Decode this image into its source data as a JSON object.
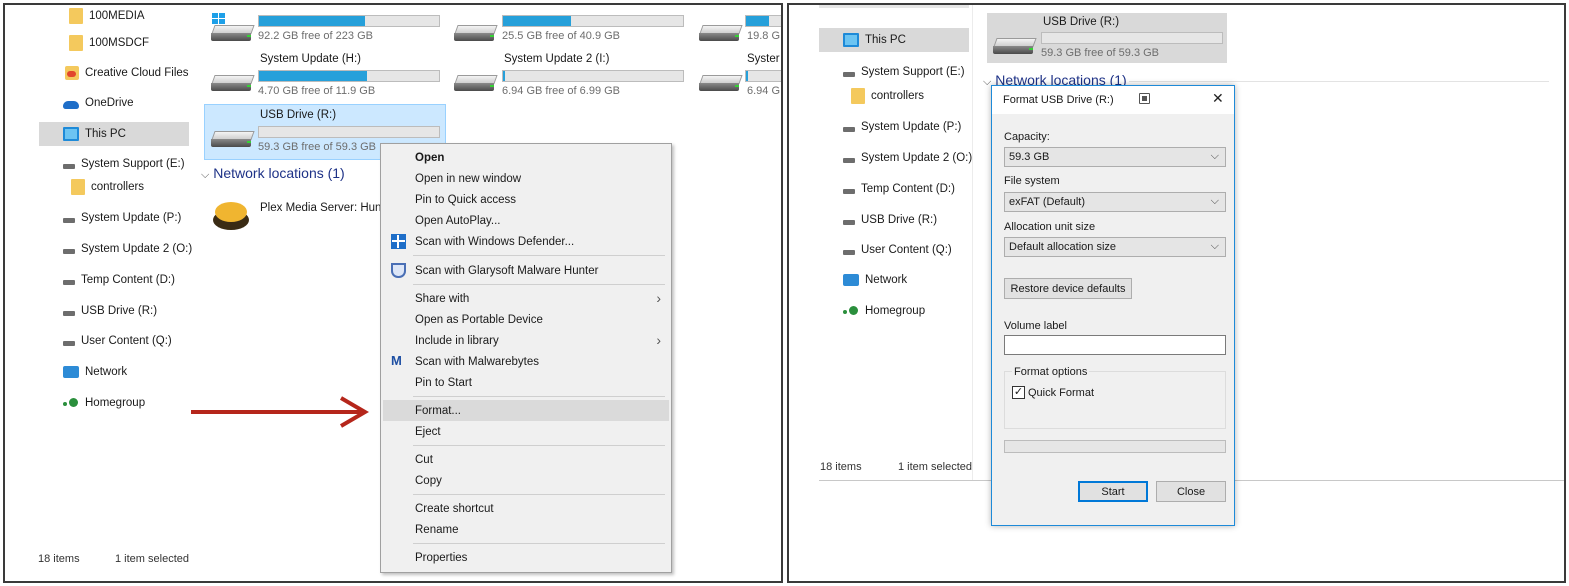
{
  "left": {
    "nav": {
      "items": [
        {
          "label": "100MEDIA"
        },
        {
          "label": "100MSDCF"
        },
        {
          "label": "Creative Cloud Files"
        },
        {
          "label": "OneDrive"
        },
        {
          "label": "This PC"
        },
        {
          "label": "System Support (E:)"
        },
        {
          "label": "controllers"
        },
        {
          "label": "System Update (P:)"
        },
        {
          "label": "System Update 2 (O:)"
        },
        {
          "label": "Temp Content (D:)"
        },
        {
          "label": "USB Drive (R:)"
        },
        {
          "label": "User Content (Q:)"
        },
        {
          "label": "Network"
        },
        {
          "label": "Homegroup"
        }
      ]
    },
    "drives": [
      {
        "title": "",
        "free": "92.2 GB free of 223 GB",
        "used_fraction": 0.59
      },
      {
        "title": "",
        "free": "25.5 GB free of 40.9 GB",
        "used_fraction": 0.38
      },
      {
        "title": "",
        "free": "19.8 G",
        "used_fraction": 0.6
      },
      {
        "title": "System Update (H:)",
        "free": "4.70 GB free of 11.9 GB",
        "used_fraction": 0.6
      },
      {
        "title": "System Update 2 (I:)",
        "free": "6.94 GB free of 6.99 GB",
        "used_fraction": 0.01
      },
      {
        "title": "Syster",
        "free": "6.94 G",
        "used_fraction": 0.05
      },
      {
        "title": "USB Drive (R:)",
        "free": "59.3 GB free of 59.3 GB",
        "used_fraction": 0.0
      }
    ],
    "network_header": "Network locations (1)",
    "network_item": "Plex Media Server: Hun",
    "status": {
      "items": "18 items",
      "selected": "1 item selected"
    },
    "context_menu": [
      {
        "label": "Open",
        "bold": true
      },
      {
        "label": "Open in new window"
      },
      {
        "label": "Pin to Quick access"
      },
      {
        "label": "Open AutoPlay..."
      },
      {
        "label": "Scan with Windows Defender..."
      },
      {
        "label": "Scan with Glarysoft Malware Hunter"
      },
      {
        "label": "Share with"
      },
      {
        "label": "Open as Portable Device"
      },
      {
        "label": "Include in library"
      },
      {
        "label": "Scan with Malwarebytes"
      },
      {
        "label": "Pin to Start"
      },
      {
        "label": "Format..."
      },
      {
        "label": "Eject"
      },
      {
        "label": "Cut"
      },
      {
        "label": "Copy"
      },
      {
        "label": "Create shortcut"
      },
      {
        "label": "Rename"
      },
      {
        "label": "Properties"
      }
    ]
  },
  "right": {
    "nav": {
      "items": [
        {
          "label": "This PC"
        },
        {
          "label": "System Support (E:)"
        },
        {
          "label": "controllers"
        },
        {
          "label": "System Update (P:)"
        },
        {
          "label": "System Update 2 (O:)"
        },
        {
          "label": "Temp Content (D:)"
        },
        {
          "label": "USB Drive (R:)"
        },
        {
          "label": "User Content (Q:)"
        },
        {
          "label": "Network"
        },
        {
          "label": "Homegroup"
        }
      ]
    },
    "drive": {
      "title": "USB Drive (R:)",
      "free": "59.3 GB free of 59.3 GB"
    },
    "network_header": "Network locations (1)",
    "status": {
      "items": "18 items",
      "selected": "1 item selected"
    },
    "dialog": {
      "title": "Format USB Drive (R:)",
      "close": "✕",
      "capacity_label": "Capacity:",
      "capacity_value": "59.3 GB",
      "filesystem_label": "File system",
      "filesystem_value": "exFAT (Default)",
      "alloc_label": "Allocation unit size",
      "alloc_value": "Default allocation size",
      "restore_button": "Restore device defaults",
      "volume_label": "Volume label",
      "volume_value": "",
      "format_options": "Format options",
      "quick_format": "Quick Format",
      "quick_format_checked": true,
      "start_button": "Start",
      "close_button": "Close"
    }
  },
  "colors": {
    "accent": "#26a0da",
    "arrow": "#b5261b",
    "highlight": "#dadada"
  }
}
